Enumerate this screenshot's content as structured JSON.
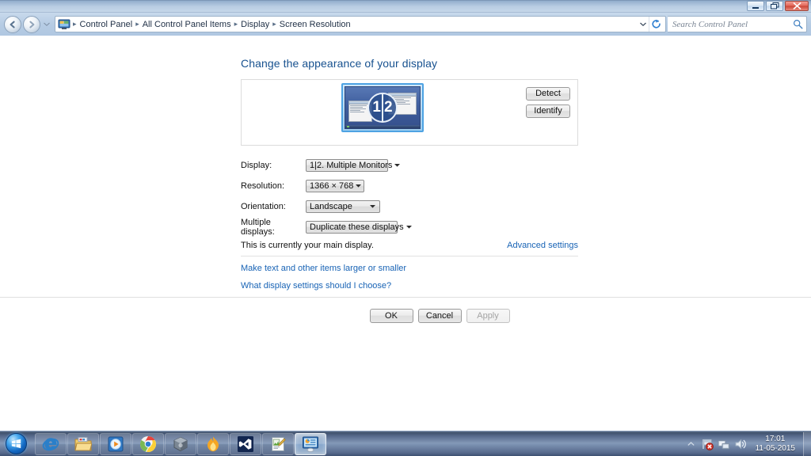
{
  "window": {
    "buttons": {
      "minimize": "minimize",
      "maximize": "restore",
      "close": "close"
    }
  },
  "addressbar": {
    "back_label": "Back",
    "forward_label": "Forward",
    "history_label": "Recent pages",
    "breadcrumbs": [
      "Control Panel",
      "All Control Panel Items",
      "Display",
      "Screen Resolution"
    ],
    "separator": "▸",
    "refresh_label": "Refresh",
    "search": {
      "placeholder": "Search Control Panel",
      "value": ""
    }
  },
  "page": {
    "title": "Change the appearance of your display",
    "preview": {
      "badge_left": "1",
      "badge_right": "2"
    },
    "side_buttons": {
      "detect": "Detect",
      "identify": "Identify"
    },
    "fields": [
      {
        "label": "Display:",
        "value": "1|2. Multiple Monitors",
        "key": "display"
      },
      {
        "label": "Resolution:",
        "value": "1366 × 768",
        "key": "resolution"
      },
      {
        "label": "Orientation:",
        "value": "Landscape",
        "key": "orientation"
      },
      {
        "label": "Multiple displays:",
        "value": "Duplicate these displays",
        "key": "multiple"
      }
    ],
    "main_display_note": "This is currently your main display.",
    "advanced_settings": "Advanced settings",
    "links": [
      "Make text and other items larger or smaller",
      "What display settings should I choose?"
    ],
    "dialog_buttons": {
      "ok": "OK",
      "cancel": "Cancel",
      "apply": "Apply",
      "apply_disabled": true
    }
  },
  "taskbar": {
    "start_label": "Start",
    "items": [
      {
        "name": "internet-explorer",
        "label": "Internet Explorer",
        "active": false
      },
      {
        "name": "windows-explorer",
        "label": "Windows Explorer",
        "active": false
      },
      {
        "name": "media-player",
        "label": "Windows Media Player",
        "active": false
      },
      {
        "name": "google-chrome",
        "label": "Google Chrome",
        "active": false
      },
      {
        "name": "virtualbox",
        "label": "Oracle VM VirtualBox",
        "active": false
      },
      {
        "name": "maxthon-browser",
        "label": "Maxthon",
        "active": false
      },
      {
        "name": "visual-studio",
        "label": "Visual Studio",
        "active": false
      },
      {
        "name": "notepad-editor",
        "label": "Editor",
        "active": false
      },
      {
        "name": "control-panel",
        "label": "Screen Resolution",
        "active": true
      }
    ],
    "tray": {
      "show_hidden_label": "Show hidden icons",
      "icons": [
        {
          "name": "action-center",
          "label": "Action Center - problems found"
        },
        {
          "name": "network",
          "label": "Network"
        },
        {
          "name": "volume",
          "label": "Volume"
        }
      ],
      "clock_time": "17:01",
      "clock_date": "11-05-2015"
    }
  },
  "colors": {
    "accent_link": "#1863b5",
    "title_heading": "#17518f",
    "titlebar_top": "#6d86a5",
    "titlebar_bottom": "#c6d7e9",
    "close_button": "#c94334",
    "taskbar_mid": "#8499b8"
  }
}
